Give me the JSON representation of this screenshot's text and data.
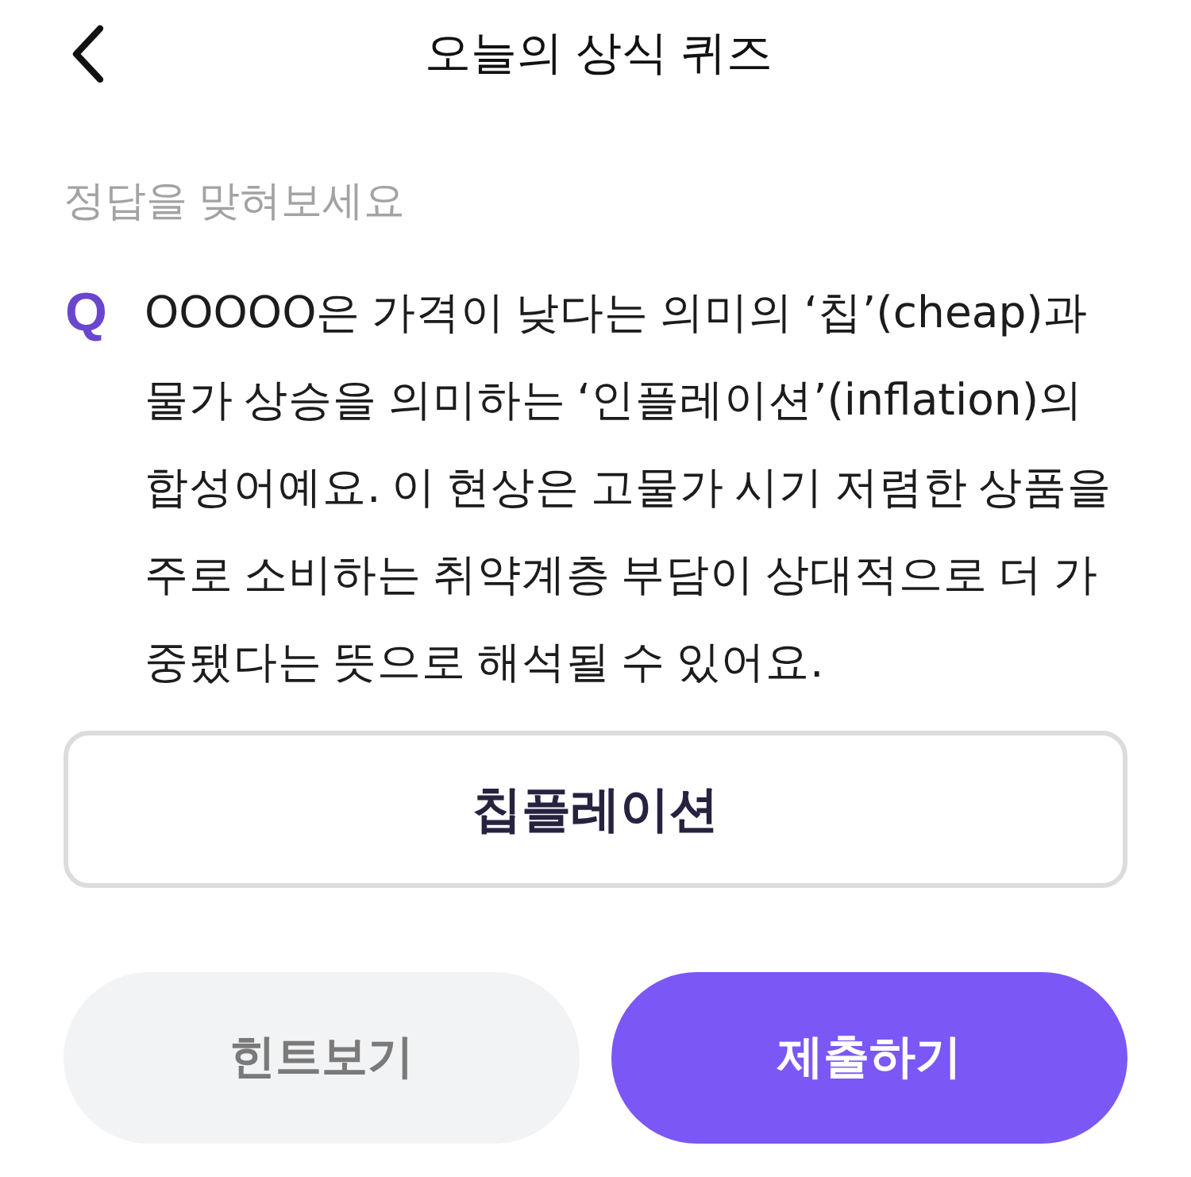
{
  "header": {
    "title": "오늘의 상식 퀴즈"
  },
  "prompt": "정답을 맞혀보세요",
  "question": {
    "marker": "Q",
    "text": "OOOOO은 가격이 낮다는 의미의 ‘칩’(cheap)과 물가 상승을 의미하는 ‘인플레이션’(inflation)의 합성어예요. 이 현상은 고물가 시기 저렴한 상품을 주로 소비하는 취약계층 부담이 상대적으로 더 가중됐다는 뜻으로 해석될 수 있어요."
  },
  "answer": {
    "value": "칩플레이션"
  },
  "buttons": [
    {
      "label": "힌트보기",
      "kind": "secondary"
    },
    {
      "label": "제출하기",
      "kind": "primary"
    }
  ]
}
